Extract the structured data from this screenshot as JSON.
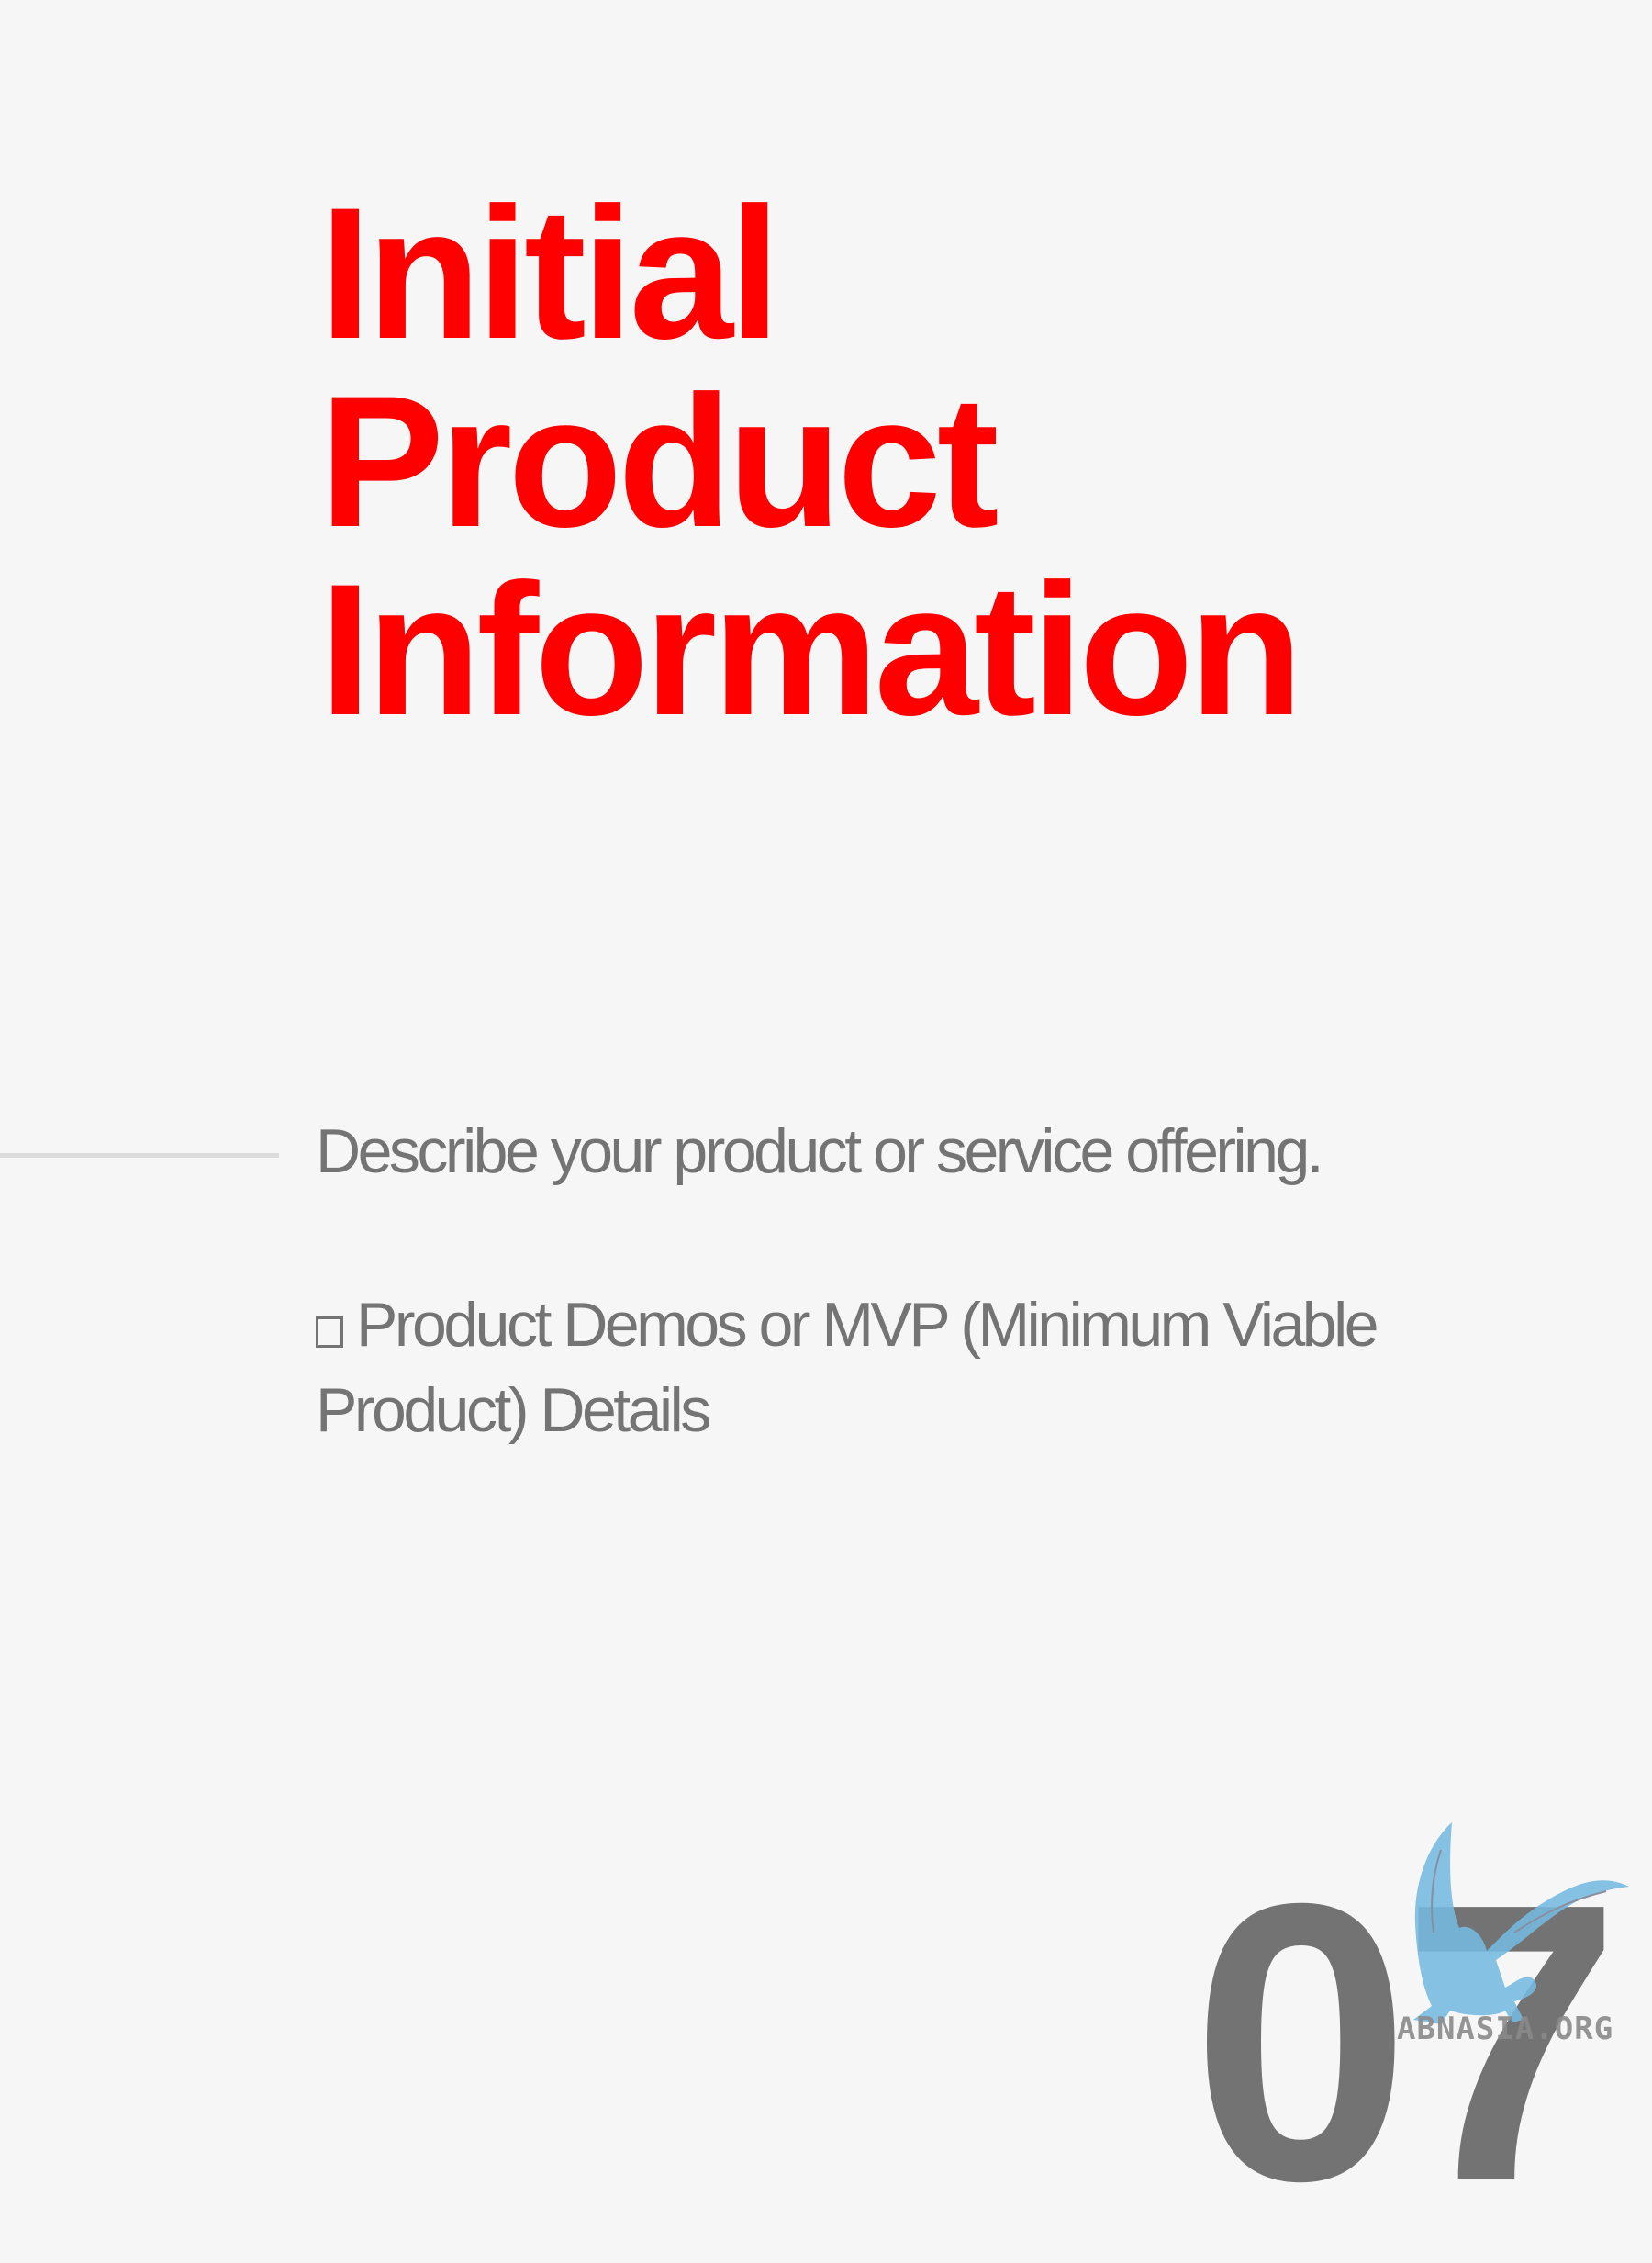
{
  "title": {
    "lines": [
      "Initial",
      "Product",
      "Information"
    ]
  },
  "description": "Describe your product or service offering.",
  "checklist": [
    {
      "checkbox_icon": "empty-square-checkbox",
      "label": "Product Demos or MVP (Minimum Viable Product) Details"
    }
  ],
  "page_number": "07",
  "watermark": {
    "text": "ABNASIA.ORG",
    "icon": "griffin-logo"
  },
  "colors": {
    "title": "#ff0000",
    "body_text": "#747474",
    "background": "#f6f6f6",
    "logo": "#74b9e0"
  }
}
